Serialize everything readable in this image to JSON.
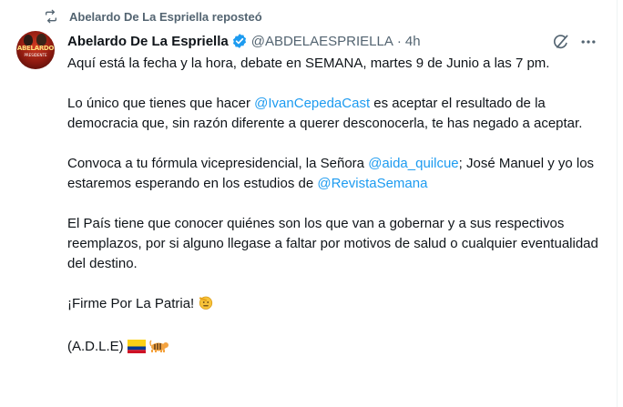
{
  "repost": {
    "icon": "repost-icon",
    "text": "Abelardo De La Espriella reposteó"
  },
  "author": {
    "display_name": "Abelardo De La Espriella",
    "handle": "@ABDELAESPRIELLA",
    "separator": "·",
    "time": "4h",
    "verified": true,
    "avatar_text": "ABELARDO",
    "avatar_subtext": "PRESIDENTE"
  },
  "actions": {
    "grok_icon": "grok-icon",
    "more_icon": "more-icon"
  },
  "tweet": {
    "p1": "Aquí está la fecha y la hora, debate en SEMANA, martes 9 de Junio a las 7 pm.",
    "p2_a": "Lo único que tienes que hacer ",
    "p2_mention": "@IvanCepedaCast",
    "p2_b": " es aceptar el resultado de la democracia que, sin razón diferente a querer desconocerla, te has negado a aceptar.",
    "p3_a": "Convoca a tu fórmula vicepresidencial, la Señora ",
    "p3_mention1": "@aida_quilcue",
    "p3_b": "; José Manuel y yo los estaremos esperando en los estudios de ",
    "p3_mention2": "@RevistaSemana",
    "p4": "El País tiene que conocer quiénes son los que van a gobernar y a sus respectivos reemplazos, por si alguno llegase a faltar por motivos de salud o cualquier eventualidad del destino.",
    "p5": "¡Firme Por La Patria!",
    "p5_emoji": "saluting-face-emoji",
    "p6": "(A.D.L.E)",
    "p6_emojis": [
      "colombia-flag-emoji",
      "tiger-emoji"
    ]
  },
  "colors": {
    "text": "#0f1419",
    "secondary": "#536471",
    "link": "#1d9bf0",
    "verified": "#1d9bf0"
  }
}
